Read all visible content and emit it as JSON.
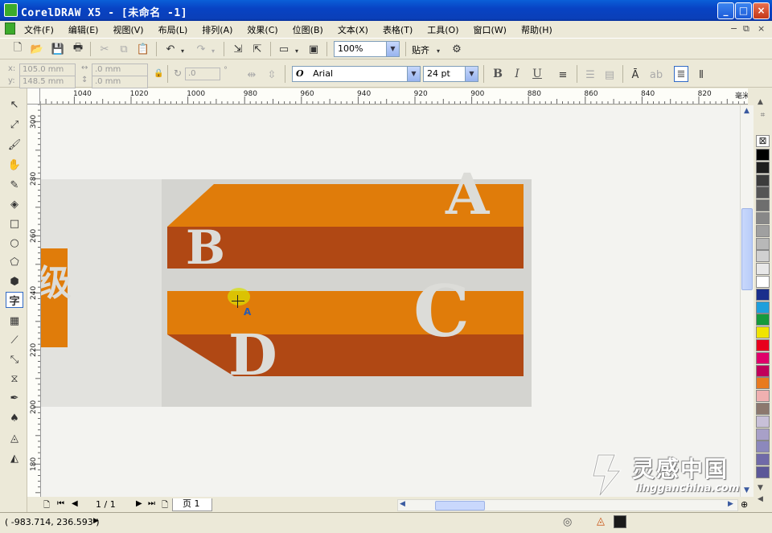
{
  "window": {
    "title": "CorelDRAW X5 - [未命名 -1]",
    "min_label": "_",
    "max_label": "□",
    "close_label": "×"
  },
  "menu": {
    "items": [
      "文件(F)",
      "编辑(E)",
      "视图(V)",
      "布局(L)",
      "排列(A)",
      "效果(C)",
      "位图(B)",
      "文本(X)",
      "表格(T)",
      "工具(O)",
      "窗口(W)",
      "帮助(H)"
    ]
  },
  "toolbar": {
    "zoom_value": "100%",
    "snap_label": "贴齐"
  },
  "property_bar": {
    "x_value": "105.0 mm",
    "y_value": "148.5 mm",
    "w_value": ".0 mm",
    "h_value": ".0 mm",
    "angle_value": ".0",
    "font_family": "Arial",
    "font_size": "24 pt",
    "x_label": "x:",
    "y_label": "y:"
  },
  "ruler": {
    "unit_label": "毫米",
    "h_labels": [
      "1040",
      "1020",
      "1000",
      "980",
      "960",
      "940",
      "920",
      "900",
      "880",
      "860",
      "840",
      "820"
    ],
    "v_labels": [
      "300",
      "280",
      "260",
      "240",
      "220",
      "200",
      "180"
    ]
  },
  "canvas": {
    "letters": [
      "A",
      "B",
      "C",
      "D"
    ],
    "left_fragment": "级",
    "cursor_label": "A",
    "colors": {
      "orange": "#e07c0a",
      "rust": "#b04814",
      "page_gray": "#d4d4d0",
      "letter_gray": "#dcdcd8"
    }
  },
  "navigation": {
    "page_counter": "1 / 1",
    "page_tab": "页 1"
  },
  "status": {
    "coordinates": "( -983.714, 236.593 )"
  },
  "palette": {
    "colors": [
      "#000000",
      "#1e1e1e",
      "#3c3c3c",
      "#555555",
      "#6e6e6e",
      "#888888",
      "#a0a0a0",
      "#b8b8b8",
      "#d0d0d0",
      "#e8e8e8",
      "#ffffff",
      "#1a2f8c",
      "#1e9fdc",
      "#169a3c",
      "#f0e400",
      "#e8001c",
      "#e0006a",
      "#c0005a",
      "#e87a1e",
      "#f0b0b0",
      "#8c786e",
      "#c8c0d8",
      "#a8a0c8",
      "#8c88bc",
      "#706aa8",
      "#5c5898"
    ]
  },
  "watermark": {
    "title": "灵感中国",
    "url": "lingganchina.com"
  }
}
